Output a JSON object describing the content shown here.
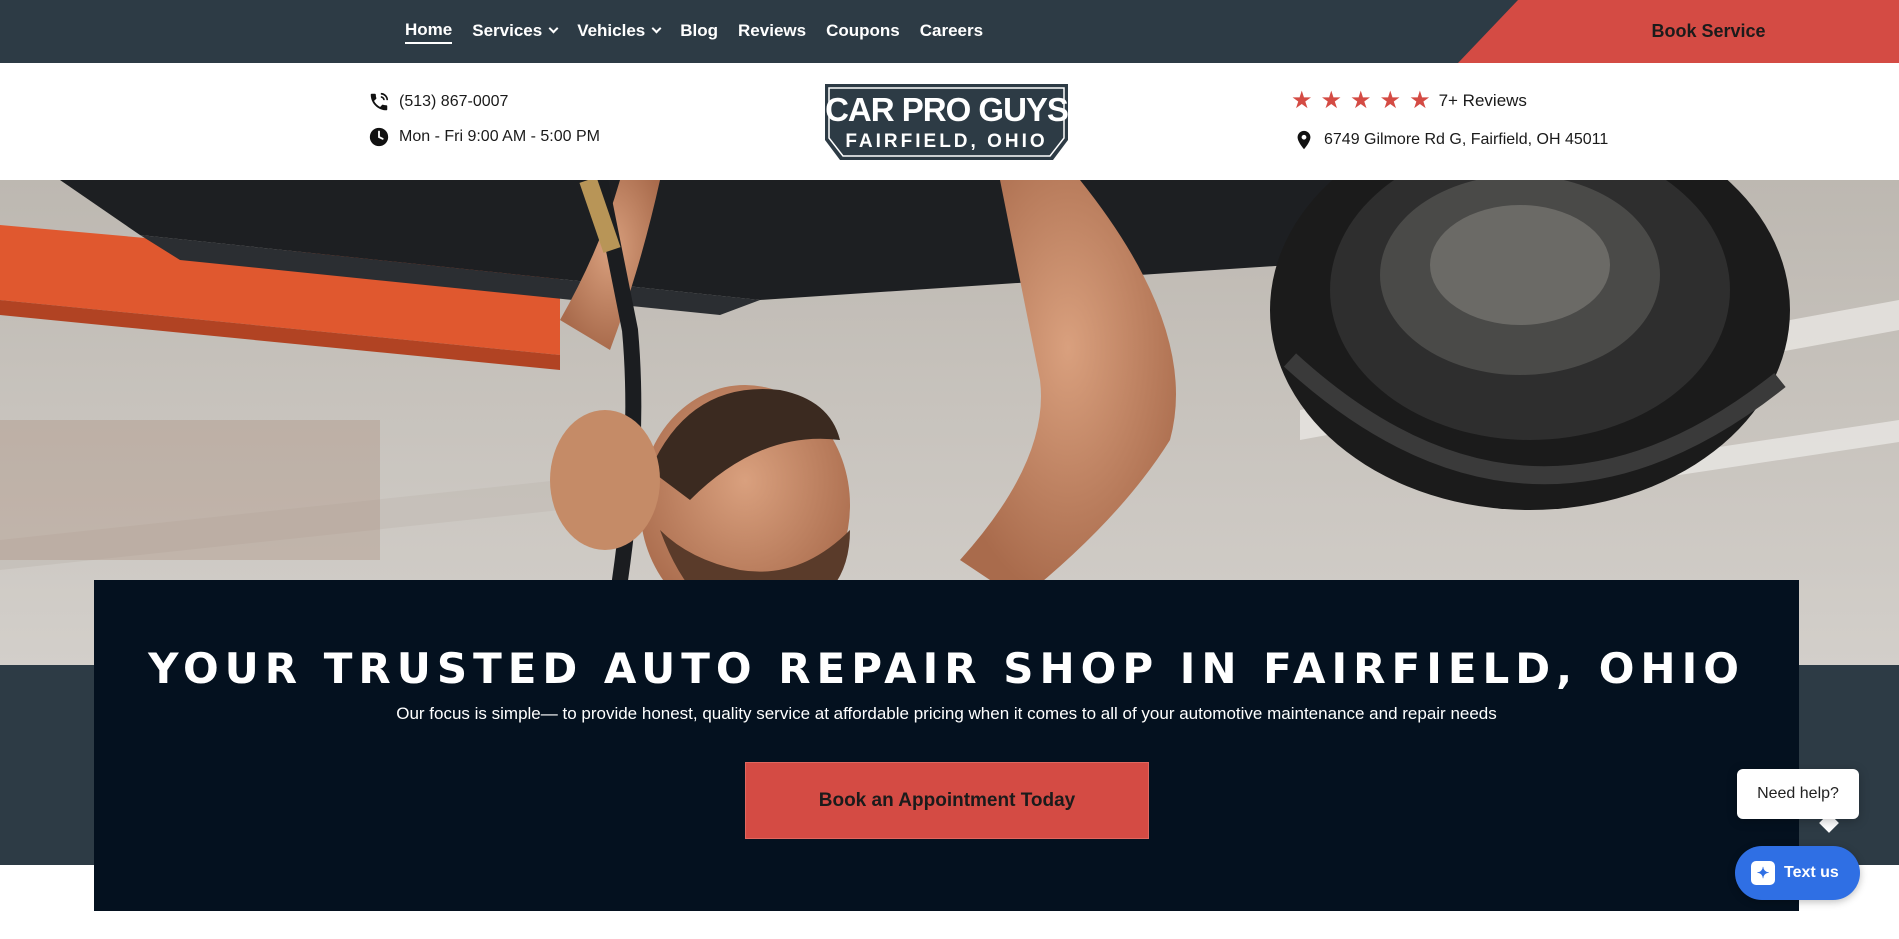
{
  "nav": {
    "items": [
      {
        "label": "Home",
        "dropdown": false,
        "active": true
      },
      {
        "label": "Services",
        "dropdown": true,
        "active": false
      },
      {
        "label": "Vehicles",
        "dropdown": true,
        "active": false
      },
      {
        "label": "Blog",
        "dropdown": false,
        "active": false
      },
      {
        "label": "Reviews",
        "dropdown": false,
        "active": false
      },
      {
        "label": "Coupons",
        "dropdown": false,
        "active": false
      },
      {
        "label": "Careers",
        "dropdown": false,
        "active": false
      }
    ],
    "book_service": "Book Service"
  },
  "info": {
    "phone": "(513) 867-0007",
    "hours": "Mon - Fri 9:00 AM - 5:00 PM",
    "rating_stars": 5,
    "reviews": "7+ Reviews",
    "address": "6749 Gilmore Rd G, Fairfield, OH 45011"
  },
  "logo": {
    "line1": "CAR PRO GUYS",
    "line2": "FAIRFIELD, OHIO"
  },
  "hero": {
    "title": "YOUR TRUSTED AUTO REPAIR SHOP IN FAIRFIELD, OHIO",
    "subtitle": "Our focus is simple— to provide honest, quality service at affordable pricing when it comes to all of your automotive maintenance and repair needs",
    "cta": "Book an Appointment Today"
  },
  "chat": {
    "prompt": "Need help?",
    "button": "Text us"
  },
  "colors": {
    "nav_bg": "#2d3b45",
    "accent": "#d44b44",
    "hero_card": "#04111f",
    "chat_blue": "#2f6fe4"
  },
  "icons": [
    "phone-icon",
    "clock-icon",
    "star-icon",
    "map-pin-icon",
    "chevron-down-icon",
    "chat-icon"
  ]
}
